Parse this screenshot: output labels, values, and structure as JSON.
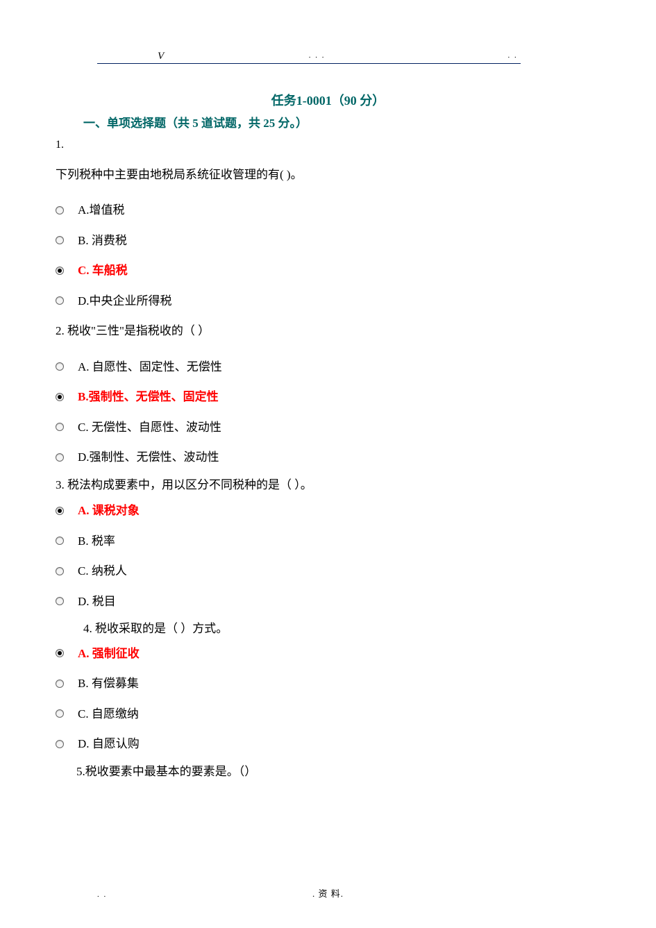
{
  "header": {
    "v": "V",
    "dots1": ". .   .",
    "dots2": ". ."
  },
  "title": "任务1-0001（90 分）",
  "section": "一、单项选择题（共 5 道试题，共 25 分。）",
  "q1": {
    "num": "1.",
    "text": "下列税种中主要由地税局系统征收管理的有( )。",
    "a": "A.增值税",
    "b": "B. 消费税",
    "c": "C. 车船税",
    "d": "D.中央企业所得税"
  },
  "q2": {
    "text": "2. 税收\"三性\"是指税收的（ ）",
    "a": "A. 自愿性、固定性、无偿性",
    "b": "B.强制性、无偿性、固定性",
    "c": "C. 无偿性、自愿性、波动性",
    "d": "D.强制性、无偿性、波动性"
  },
  "q3": {
    "text": "3. 税法构成要素中，用以区分不同税种的是（ ）。",
    "a": "A. 课税对象",
    "b": "B. 税率",
    "c": "C. 纳税人",
    "d": "D. 税目"
  },
  "q4": {
    "text": "4. 税收采取的是（ ）方式。",
    "a": "A. 强制征收",
    "b": "B. 有偿募集",
    "c": "C. 自愿缴纳",
    "d": "D. 自愿认购"
  },
  "q5": {
    "text": "5.税收要素中最基本的要素是。（）"
  },
  "footer": {
    "left": ". .",
    "center": ". 资 料."
  }
}
